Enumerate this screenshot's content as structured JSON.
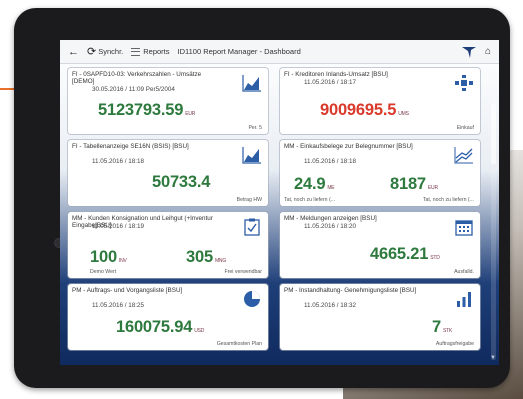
{
  "toolbar": {
    "back_icon": "arrow-left-icon",
    "refresh_label": "Synchr.",
    "reports_label": "Reports",
    "title": "ID1100 Report Manager - Dashboard",
    "home_icon": "home-icon"
  },
  "tiles": [
    {
      "title": "FI - 0SAPFD10-03: Verkehrszahlen - Umsätze [DEMO]",
      "subtitle": "30.05.2016 / 11:09 Per5/2004",
      "icon": "area-chart-icon",
      "value": "5123793.59",
      "unit": "EUR",
      "caption": "Per. 5"
    },
    {
      "title": "FI - Kreditoren Inlands-Umsatz [BSU]",
      "subtitle": "11.05.2016 / 18:17",
      "icon": "network-icon",
      "value": "9009695.5",
      "unit": "UMS",
      "caption": "Einkauf"
    },
    {
      "title": "FI - Tabellenanzeige SE16N (BSIS) [BSU]",
      "subtitle": "11.05.2016 / 18:18",
      "icon": "area-chart-icon",
      "value": "50733.4",
      "unit": "",
      "caption": "Betrag HW"
    },
    {
      "title": "MM - Einkaufsbelege zur Belegnummer [BSU]",
      "subtitle": "11.05.2016 / 18:18",
      "icon": "line-chart-icon",
      "value": "24.9",
      "unit": "ME",
      "caption": "Tat, noch zu liefern (...",
      "value2": "8187",
      "unit2": "EUR",
      "caption2": "Tat, noch zu liefern (..."
    },
    {
      "title": "MM - Kunden Konsignation und Leihgut (+Inventur Eingabe[BSU]",
      "subtitle": "11.05.2016 / 18:19",
      "icon": "checklist-icon",
      "value": "100",
      "unit": "INV",
      "caption": "Demo Wert",
      "value2": "305",
      "unit2": "MNG",
      "caption2": "Frei verwendbar"
    },
    {
      "title": "MM - Meldungen anzeigen [BSU]",
      "subtitle": "11.05.2016 / 18:20",
      "icon": "calendar-icon",
      "value": "4665.21",
      "unit": "STD",
      "caption": "Ausfalld."
    },
    {
      "title": "PM - Auftrags- und Vorgangsliste [BSU]",
      "subtitle": "11.05.2016 / 18:25",
      "icon": "pie-chart-icon",
      "value": "160075.94",
      "unit": "USD",
      "caption": "Gesamtkosten Plan"
    },
    {
      "title": "PM - Instandhaltung- Genehmigungsliste [BSU]",
      "subtitle": "11.05.2016 / 18:32",
      "icon": "bar-chart-icon",
      "value": "7",
      "unit": "STK",
      "caption": "Auftragsfreigabe"
    }
  ],
  "colors": {
    "value_green": "#2e7a3e",
    "value_red": "#d93a2b",
    "icon_blue": "#2c5ea8",
    "accent_orange": "#e8702a"
  }
}
